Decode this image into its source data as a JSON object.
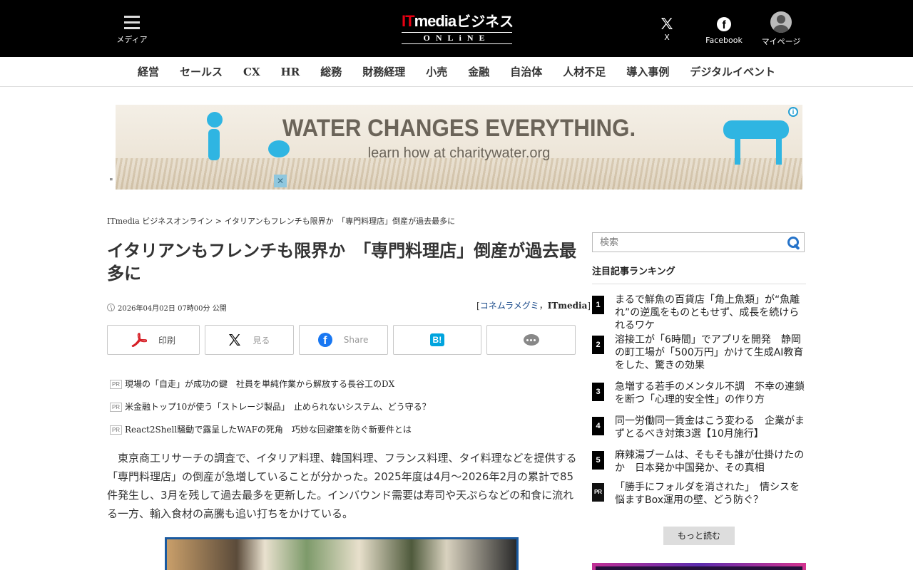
{
  "header": {
    "menu_label": "メディア",
    "logo_it": "IT",
    "logo_media": "media",
    "logo_biz": "ビジネス",
    "logo_sub": "ONLiNE",
    "x_label": "X",
    "facebook_label": "Facebook",
    "mypage_label": "マイページ"
  },
  "nav": {
    "items": [
      "経営",
      "セールス",
      "CX",
      "HR",
      "総務",
      "財務経理",
      "小売",
      "金融",
      "自治体",
      "人材不足",
      "導入事例",
      "デジタルイベント"
    ]
  },
  "ad": {
    "quote_mark": "\"",
    "headline": "WATER CHANGES EVERYTHING.",
    "subline": "learn how at charitywater.org"
  },
  "breadcrumb": {
    "home": "ITmedia ビジネスオンライン",
    "separator": " > ",
    "current": "イタリアンもフレンチも限界か　「専門料理店」倒産が過去最多に"
  },
  "article": {
    "title": "イタリアンもフレンチも限界か　「専門料理店」倒産が過去最多に",
    "date": "2026年04月02日 07時00分 公開",
    "byline_open": "[",
    "author": "コネムラメグミ",
    "byline_sep": "，",
    "publisher": "ITmedia",
    "byline_close": "]",
    "share": {
      "print": "印刷",
      "x": "見る",
      "facebook": "Share"
    },
    "pr_tag": "PR",
    "pr_links": [
      "現場の「自走」が成功の鍵　社員を単純作業から解放する長谷工のDX",
      "米金融トップ10が使う「ストレージ製品」　止められないシステム、どう守る？",
      "React2Shell騒動で露呈したWAFの死角　巧妙な回避策を防ぐ新要件とは"
    ],
    "lead": "東京商工リサーチの調査で、イタリア料理、韓国料理、フランス料理、タイ料理などを提供する「専門料理店」の倒産が急増していることが分かった。2025年度は4月～2026年2月の累計で85件発生し、3月を残して過去最多を更新した。インバウンド需要は寿司や天ぷらなどの和食に流れる一方、輸入食材の高騰も追い打ちをかけている。"
  },
  "sidebar": {
    "search_placeholder": "検索",
    "ranking_title": "注目記事ランキング",
    "ranking": [
      {
        "num": "1",
        "text": "まるで鮮魚の百貨店「角上魚類」が“魚離れ”の逆風をものともせず、成長を続けられるワケ"
      },
      {
        "num": "2",
        "text": "溶接工が「6時間」でアプリを開発　静岡の町工場が「500万円」かけて生成AI教育をした、驚きの効果"
      },
      {
        "num": "3",
        "text": "急増する若手のメンタル不調　不幸の連鎖を断つ「心理的安全性」の作り方"
      },
      {
        "num": "4",
        "text": "同一労働同一賃金はこう変わる　企業がまずとるべき対策3選【10月施行】"
      },
      {
        "num": "5",
        "text": "麻辣湯ブームは、そもそも誰が仕掛けたのか　日本発か中国発か、その真相"
      },
      {
        "num": "PR",
        "text": "「勝手にフォルダを消された」　情シスを悩ますBox運用の壁、どう防ぐ？"
      }
    ],
    "more_label": "もっと読む"
  }
}
